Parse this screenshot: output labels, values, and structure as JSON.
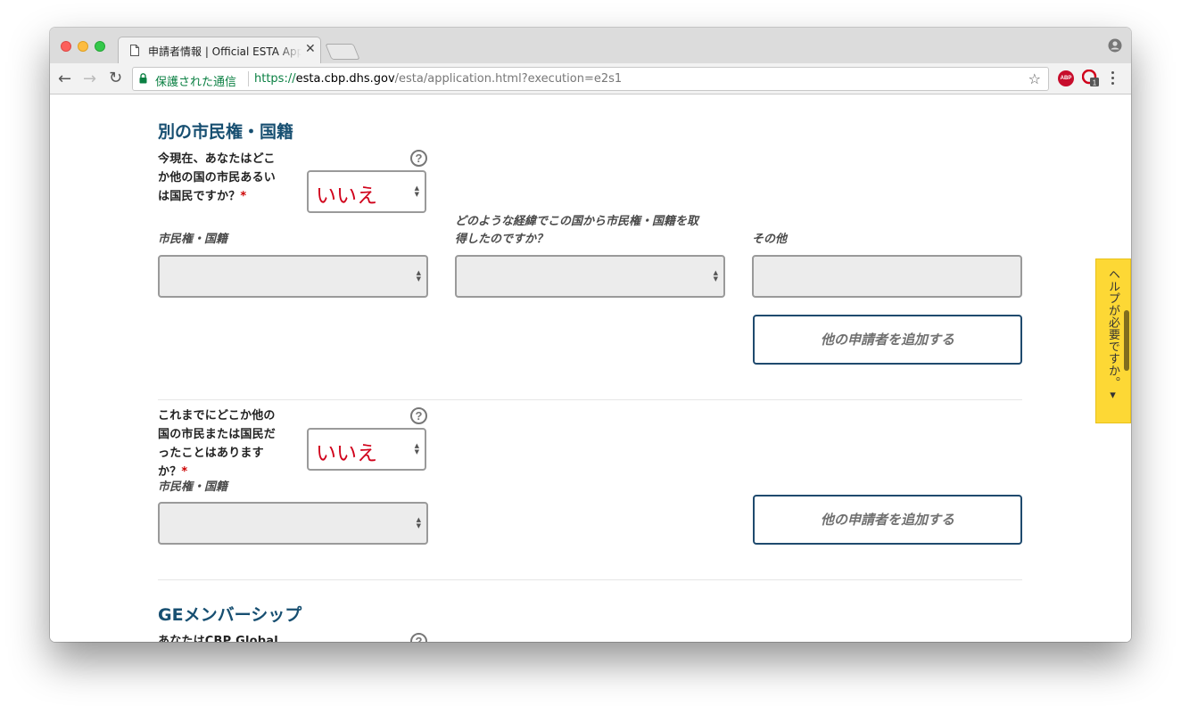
{
  "browser": {
    "tab_title": "申請者情報 | Official ESTA Application",
    "secure_label": "保護された通信",
    "url_scheme": "https://",
    "url_host": "esta.cbp.dhs.gov",
    "url_path": "/esta/application.html?execution=e2s1",
    "abp_label": "ABP",
    "ext_badge": "1"
  },
  "section1": {
    "title": "別の市民権・国籍",
    "q1": {
      "label": "今現在、あなたはどこか他の国の市民あるいは国民ですか？",
      "required": "*",
      "answer": "いいえ",
      "help": "?"
    },
    "fields": {
      "citizenship_label": "市民権・国籍",
      "how_label": "どのような経緯でこの国から市民権・国籍を取得したのですか？",
      "other_label": "その他"
    },
    "add_button": "他の申請者を追加する",
    "q2": {
      "label": "これまでにどこか他の国の市民または国民だったことはありますか？",
      "required": "*",
      "answer": "いいえ",
      "help": "?",
      "citizenship_label": "市民権・国籍"
    },
    "add_button2": "他の申請者を追加する"
  },
  "section2": {
    "title": "GEメンバーシップ",
    "q1_label": "あなたはCBP Global",
    "help": "?"
  },
  "help_tab": {
    "label": "ヘルプが必要ですか。▾"
  },
  "colors": {
    "section_title": "#174f71",
    "answer_red": "#d0021b",
    "button_border": "#1f4a6e",
    "help_tab_bg": "#fdd835"
  }
}
